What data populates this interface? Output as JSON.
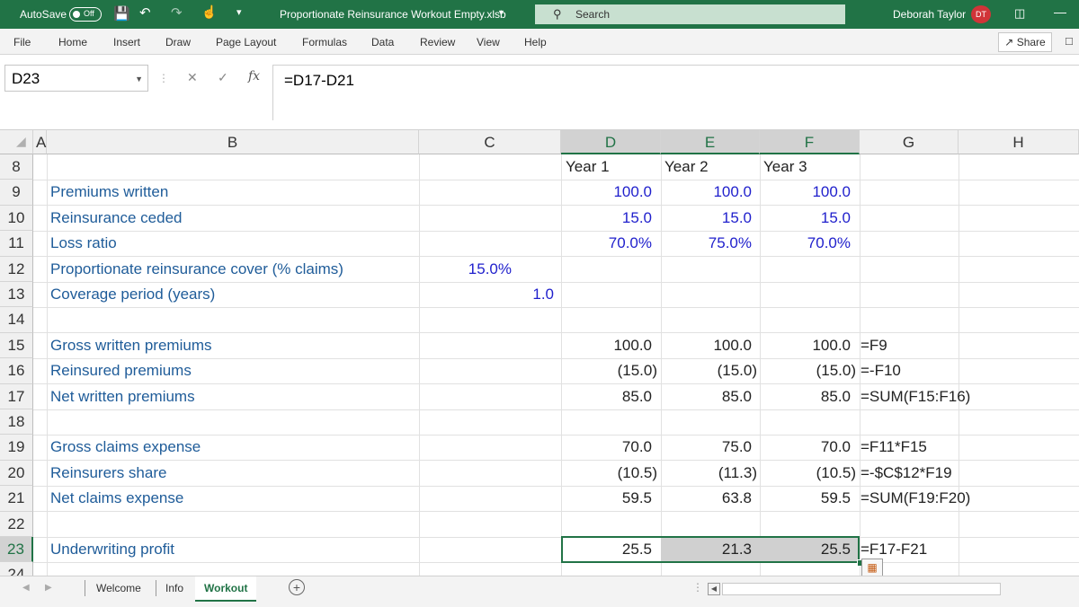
{
  "titlebar": {
    "autosave_label": "AutoSave",
    "autosave_state": "Off",
    "filename": "Proportionate Reinsurance Workout Empty.xlsb",
    "search_placeholder": "Search",
    "user_name": "Deborah Taylor",
    "user_initials": "DT"
  },
  "ribbon": {
    "tabs": [
      "File",
      "Home",
      "Insert",
      "Draw",
      "Page Layout",
      "Formulas",
      "Data",
      "Review",
      "View",
      "Help"
    ],
    "share_label": "Share"
  },
  "formula_bar": {
    "name_box": "D23",
    "fx": "fx",
    "formula": "=D17-D21"
  },
  "columns": [
    "A",
    "B",
    "C",
    "D",
    "E",
    "F",
    "G",
    "H"
  ],
  "rows": [
    "8",
    "9",
    "10",
    "11",
    "12",
    "13",
    "14",
    "15",
    "16",
    "17",
    "18",
    "19",
    "20",
    "21",
    "22",
    "23",
    "24"
  ],
  "cells": {
    "r8": {
      "D": "Year 1",
      "E": "Year 2",
      "F": "Year 3"
    },
    "r9": {
      "B": "Premiums written",
      "D": "100.0",
      "E": "100.0",
      "F": "100.0"
    },
    "r10": {
      "B": "Reinsurance ceded",
      "D": "15.0",
      "E": "15.0",
      "F": "15.0"
    },
    "r11": {
      "B": "Loss ratio",
      "D": "70.0%",
      "E": "75.0%",
      "F": "70.0%"
    },
    "r12": {
      "B": "Proportionate reinsurance cover (% claims)",
      "C": "15.0%"
    },
    "r13": {
      "B": "Coverage period (years)",
      "C": "1.0"
    },
    "r15": {
      "B": "Gross written premiums",
      "D": "100.0",
      "E": "100.0",
      "F": "100.0",
      "G": "=F9"
    },
    "r16": {
      "B": "Reinsured premiums",
      "D": "(15.0)",
      "E": "(15.0)",
      "F": "(15.0)",
      "G": "=-F10"
    },
    "r17": {
      "B": "Net written premiums",
      "D": "85.0",
      "E": "85.0",
      "F": "85.0",
      "G": "=SUM(F15:F16)"
    },
    "r19": {
      "B": "Gross claims expense",
      "D": "70.0",
      "E": "75.0",
      "F": "70.0",
      "G": "=F11*F15"
    },
    "r20": {
      "B": "Reinsurers share",
      "D": "(10.5)",
      "E": "(11.3)",
      "F": "(10.5)",
      "G": "=-$C$12*F19"
    },
    "r21": {
      "B": "Net claims expense",
      "D": "59.5",
      "E": "63.8",
      "F": "59.5",
      "G": "=SUM(F19:F20)"
    },
    "r23": {
      "B": "Underwriting profit",
      "D": "25.5",
      "E": "21.3",
      "F": "25.5",
      "G": "=F17-F21"
    }
  },
  "sheets": [
    "Welcome",
    "Info",
    "Workout"
  ],
  "active_sheet": "Workout",
  "colors": {
    "excel_green": "#217346",
    "input_blue": "#1f1fcc",
    "label_blue": "#1f5c99"
  }
}
